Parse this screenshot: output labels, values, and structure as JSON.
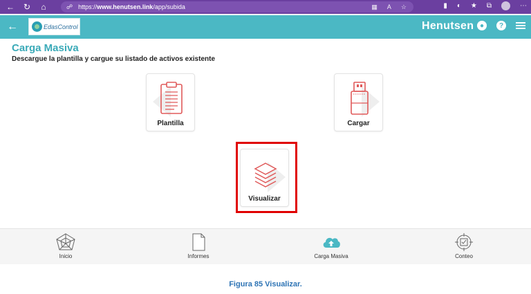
{
  "browser": {
    "url_prefix": "https://",
    "url_host": "www.henutsen.link",
    "url_path": "/app/subida",
    "back_icon": "←",
    "refresh_icon": "↻",
    "home_icon": "⌂",
    "lock_icon": "🔒"
  },
  "header": {
    "back_icon": "←",
    "logo_text": "EdasControl",
    "brand": "Henutsen",
    "user_icon": "●",
    "help_icon": "?"
  },
  "page": {
    "title": "Carga Masiva",
    "subtitle": "Descargue la plantilla y cargue su listado de activos existente"
  },
  "cards": {
    "plantilla": "Plantilla",
    "cargar": "Cargar",
    "visualizar": "Visualizar"
  },
  "bottom_nav": {
    "inicio": "Inicio",
    "informes": "Informes",
    "carga_masiva": "Carga Masiva",
    "conteo": "Conteo"
  },
  "caption": "Figura 85 Visualizar.",
  "colors": {
    "browser": "#6b3fa0",
    "header": "#4bb8c4",
    "accent": "#3aaab8",
    "icon_red": "#e05a5a",
    "highlight": "#e00000",
    "caption": "#2e74b5"
  }
}
